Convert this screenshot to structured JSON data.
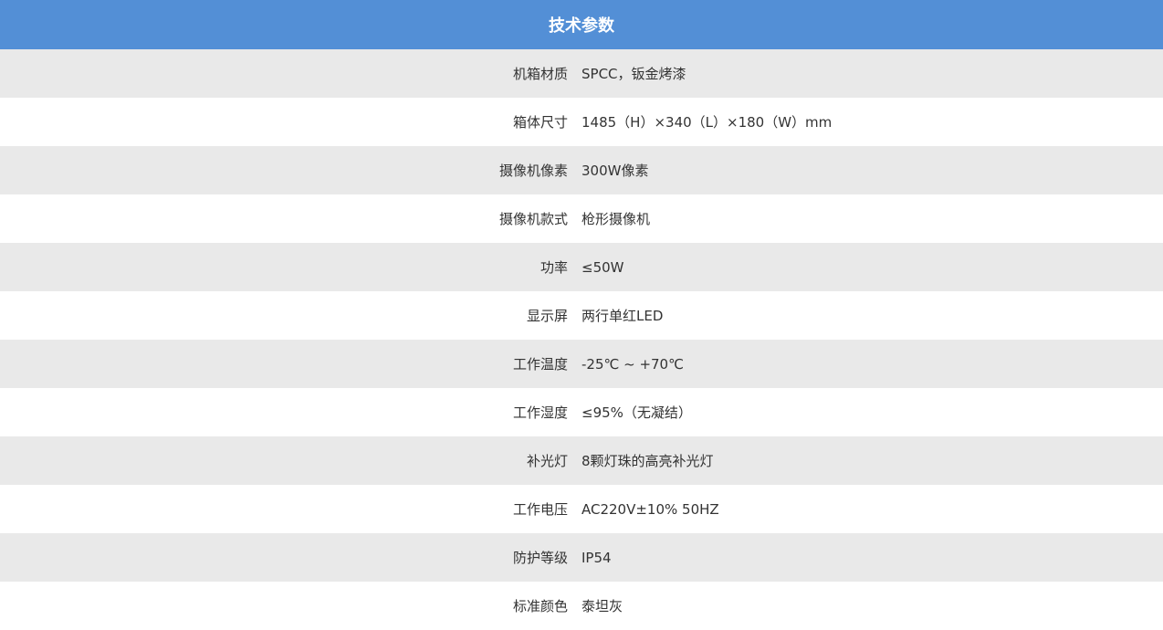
{
  "table": {
    "title": "技术参数",
    "rows": [
      {
        "label": "机箱材质",
        "value": "SPCC，钣金烤漆"
      },
      {
        "label": "箱体尺寸",
        "value": "1485（H）×340（L）×180（W）mm"
      },
      {
        "label": "摄像机像素",
        "value": "300W像素"
      },
      {
        "label": "摄像机款式",
        "value": "枪形摄像机"
      },
      {
        "label": "功率",
        "value": "≤50W"
      },
      {
        "label": "显示屏",
        "value": "两行单红LED"
      },
      {
        "label": "工作温度",
        "value": "-25℃ ~ +70℃"
      },
      {
        "label": "工作湿度",
        "value": "≤95%（无凝结）"
      },
      {
        "label": "补光灯",
        "value": "8颗灯珠的高亮补光灯"
      },
      {
        "label": "工作电压",
        "value": "AC220V±10% 50HZ"
      },
      {
        "label": "防护等级",
        "value": "IP54"
      },
      {
        "label": "标准颜色",
        "value": "泰坦灰"
      }
    ]
  },
  "colors": {
    "header_background": "#538fd6",
    "header_text": "#ffffff",
    "row_alt_background": "#e9e9e9",
    "text": "#333333"
  }
}
